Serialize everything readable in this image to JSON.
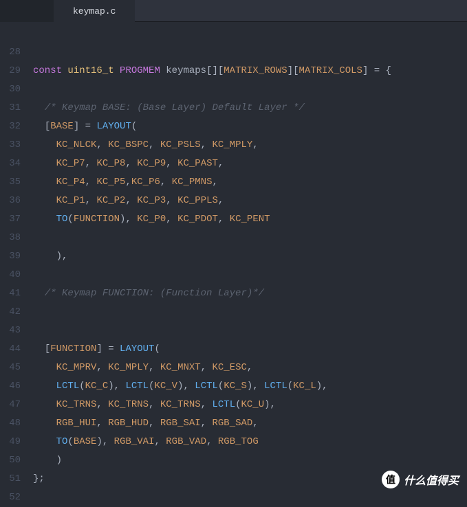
{
  "tab": {
    "filename": "keymap.c"
  },
  "gutter": {
    "start": 28,
    "end": 52,
    "blank_first": true
  },
  "code": {
    "lines": [
      [],
      [],
      [
        {
          "t": "kw",
          "s": "const"
        },
        {
          "t": "sp",
          "s": " "
        },
        {
          "t": "type",
          "s": "uint16_t"
        },
        {
          "t": "sp",
          "s": " "
        },
        {
          "t": "stor",
          "s": "PROGMEM"
        },
        {
          "t": "sp",
          "s": " "
        },
        {
          "t": "id",
          "s": "keymaps[]["
        },
        {
          "t": "const",
          "s": "MATRIX_ROWS"
        },
        {
          "t": "id",
          "s": "]["
        },
        {
          "t": "const",
          "s": "MATRIX_COLS"
        },
        {
          "t": "id",
          "s": "] = {"
        }
      ],
      [],
      [
        {
          "t": "sp",
          "s": "  "
        },
        {
          "t": "cmt",
          "s": "/* Keymap BASE: (Base Layer) Default Layer */"
        }
      ],
      [
        {
          "t": "sp",
          "s": "  "
        },
        {
          "t": "id",
          "s": "["
        },
        {
          "t": "const",
          "s": "BASE"
        },
        {
          "t": "id",
          "s": "] = "
        },
        {
          "t": "func",
          "s": "LAYOUT"
        },
        {
          "t": "id",
          "s": "("
        }
      ],
      [
        {
          "t": "sp",
          "s": "    "
        },
        {
          "t": "const",
          "s": "KC_NLCK"
        },
        {
          "t": "id",
          "s": ", "
        },
        {
          "t": "const",
          "s": "KC_BSPC"
        },
        {
          "t": "id",
          "s": ", "
        },
        {
          "t": "const",
          "s": "KC_PSLS"
        },
        {
          "t": "id",
          "s": ", "
        },
        {
          "t": "const",
          "s": "KC_MPLY"
        },
        {
          "t": "id",
          "s": ","
        }
      ],
      [
        {
          "t": "sp",
          "s": "    "
        },
        {
          "t": "const",
          "s": "KC_P7"
        },
        {
          "t": "id",
          "s": ", "
        },
        {
          "t": "const",
          "s": "KC_P8"
        },
        {
          "t": "id",
          "s": ", "
        },
        {
          "t": "const",
          "s": "KC_P9"
        },
        {
          "t": "id",
          "s": ", "
        },
        {
          "t": "const",
          "s": "KC_PAST"
        },
        {
          "t": "id",
          "s": ","
        }
      ],
      [
        {
          "t": "sp",
          "s": "    "
        },
        {
          "t": "const",
          "s": "KC_P4"
        },
        {
          "t": "id",
          "s": ", "
        },
        {
          "t": "const",
          "s": "KC_P5"
        },
        {
          "t": "id",
          "s": ","
        },
        {
          "t": "const",
          "s": "KC_P6"
        },
        {
          "t": "id",
          "s": ", "
        },
        {
          "t": "const",
          "s": "KC_PMNS"
        },
        {
          "t": "id",
          "s": ","
        }
      ],
      [
        {
          "t": "sp",
          "s": "    "
        },
        {
          "t": "const",
          "s": "KC_P1"
        },
        {
          "t": "id",
          "s": ", "
        },
        {
          "t": "const",
          "s": "KC_P2"
        },
        {
          "t": "id",
          "s": ", "
        },
        {
          "t": "const",
          "s": "KC_P3"
        },
        {
          "t": "id",
          "s": ", "
        },
        {
          "t": "const",
          "s": "KC_PPLS"
        },
        {
          "t": "id",
          "s": ","
        }
      ],
      [
        {
          "t": "sp",
          "s": "    "
        },
        {
          "t": "func",
          "s": "TO"
        },
        {
          "t": "id",
          "s": "("
        },
        {
          "t": "const",
          "s": "FUNCTION"
        },
        {
          "t": "id",
          "s": "), "
        },
        {
          "t": "const",
          "s": "KC_P0"
        },
        {
          "t": "id",
          "s": ", "
        },
        {
          "t": "const",
          "s": "KC_PDOT"
        },
        {
          "t": "id",
          "s": ", "
        },
        {
          "t": "const",
          "s": "KC_PENT"
        }
      ],
      [],
      [
        {
          "t": "sp",
          "s": "    "
        },
        {
          "t": "id",
          "s": "),"
        }
      ],
      [],
      [
        {
          "t": "sp",
          "s": "  "
        },
        {
          "t": "cmt",
          "s": "/* Keymap FUNCTION: (Function Layer)*/"
        }
      ],
      [],
      [],
      [
        {
          "t": "sp",
          "s": "  "
        },
        {
          "t": "id",
          "s": "["
        },
        {
          "t": "const",
          "s": "FUNCTION"
        },
        {
          "t": "id",
          "s": "] = "
        },
        {
          "t": "func",
          "s": "LAYOUT"
        },
        {
          "t": "id",
          "s": "("
        }
      ],
      [
        {
          "t": "sp",
          "s": "    "
        },
        {
          "t": "const",
          "s": "KC_MPRV"
        },
        {
          "t": "id",
          "s": ", "
        },
        {
          "t": "const",
          "s": "KC_MPLY"
        },
        {
          "t": "id",
          "s": ", "
        },
        {
          "t": "const",
          "s": "KC_MNXT"
        },
        {
          "t": "id",
          "s": ", "
        },
        {
          "t": "const",
          "s": "KC_ESC"
        },
        {
          "t": "id",
          "s": ","
        }
      ],
      [
        {
          "t": "sp",
          "s": "    "
        },
        {
          "t": "func",
          "s": "LCTL"
        },
        {
          "t": "id",
          "s": "("
        },
        {
          "t": "const",
          "s": "KC_C"
        },
        {
          "t": "id",
          "s": "), "
        },
        {
          "t": "func",
          "s": "LCTL"
        },
        {
          "t": "id",
          "s": "("
        },
        {
          "t": "const",
          "s": "KC_V"
        },
        {
          "t": "id",
          "s": "), "
        },
        {
          "t": "func",
          "s": "LCTL"
        },
        {
          "t": "id",
          "s": "("
        },
        {
          "t": "const",
          "s": "KC_S"
        },
        {
          "t": "id",
          "s": "), "
        },
        {
          "t": "func",
          "s": "LCTL"
        },
        {
          "t": "id",
          "s": "("
        },
        {
          "t": "const",
          "s": "KC_L"
        },
        {
          "t": "id",
          "s": "),"
        }
      ],
      [
        {
          "t": "sp",
          "s": "    "
        },
        {
          "t": "const",
          "s": "KC_TRNS"
        },
        {
          "t": "id",
          "s": ", "
        },
        {
          "t": "const",
          "s": "KC_TRNS"
        },
        {
          "t": "id",
          "s": ", "
        },
        {
          "t": "const",
          "s": "KC_TRNS"
        },
        {
          "t": "id",
          "s": ", "
        },
        {
          "t": "func",
          "s": "LCTL"
        },
        {
          "t": "id",
          "s": "("
        },
        {
          "t": "const",
          "s": "KC_U"
        },
        {
          "t": "id",
          "s": "),"
        }
      ],
      [
        {
          "t": "sp",
          "s": "    "
        },
        {
          "t": "const",
          "s": "RGB_HUI"
        },
        {
          "t": "id",
          "s": ", "
        },
        {
          "t": "const",
          "s": "RGB_HUD"
        },
        {
          "t": "id",
          "s": ", "
        },
        {
          "t": "const",
          "s": "RGB_SAI"
        },
        {
          "t": "id",
          "s": ", "
        },
        {
          "t": "const",
          "s": "RGB_SAD"
        },
        {
          "t": "id",
          "s": ","
        }
      ],
      [
        {
          "t": "sp",
          "s": "    "
        },
        {
          "t": "func",
          "s": "TO"
        },
        {
          "t": "id",
          "s": "("
        },
        {
          "t": "const",
          "s": "BASE"
        },
        {
          "t": "id",
          "s": "), "
        },
        {
          "t": "const",
          "s": "RGB_VAI"
        },
        {
          "t": "id",
          "s": ", "
        },
        {
          "t": "const",
          "s": "RGB_VAD"
        },
        {
          "t": "id",
          "s": ", "
        },
        {
          "t": "const",
          "s": "RGB_TOG"
        }
      ],
      [
        {
          "t": "sp",
          "s": "    "
        },
        {
          "t": "id",
          "s": ")"
        }
      ],
      [
        {
          "t": "id",
          "s": "};"
        }
      ],
      []
    ]
  },
  "watermark": {
    "badge": "值",
    "text": "什么值得买"
  }
}
